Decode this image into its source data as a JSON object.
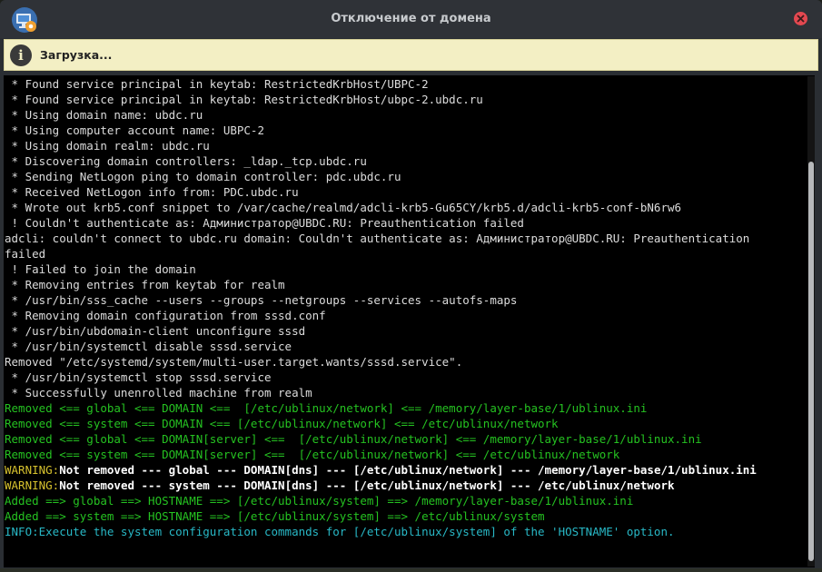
{
  "window": {
    "title": "Отключение от домена",
    "app_icon": "domain-monitor-gear-icon",
    "close_icon": "close-icon"
  },
  "infobar": {
    "icon": "info-icon",
    "text": "Загрузка..."
  },
  "colors": {
    "titlebar": "#2f3237",
    "infobar_bg": "#f3efc4",
    "terminal_bg": "#000000",
    "text_default": "#dcdcdc",
    "text_green": "#25c221",
    "text_cyan": "#28b8c6",
    "warning_keyword": "#d7c22e",
    "close_button": "#e34850"
  },
  "terminal": {
    "scroll_position": 0.96,
    "lines": [
      {
        "style": "default",
        "text": " * Found service principal in keytab: RestrictedKrbHost/UBPC-2"
      },
      {
        "style": "default",
        "text": " * Found service principal in keytab: RestrictedKrbHost/ubpc-2.ubdc.ru"
      },
      {
        "style": "default",
        "text": " * Using domain name: ubdc.ru"
      },
      {
        "style": "default",
        "text": " * Using computer account name: UBPC-2"
      },
      {
        "style": "default",
        "text": " * Using domain realm: ubdc.ru"
      },
      {
        "style": "default",
        "text": " * Discovering domain controllers: _ldap._tcp.ubdc.ru"
      },
      {
        "style": "default",
        "text": " * Sending NetLogon ping to domain controller: pdc.ubdc.ru"
      },
      {
        "style": "default",
        "text": " * Received NetLogon info from: PDC.ubdc.ru"
      },
      {
        "style": "default",
        "text": " * Wrote out krb5.conf snippet to /var/cache/realmd/adcli-krb5-Gu65CY/krb5.d/adcli-krb5-conf-bN6rw6"
      },
      {
        "style": "default",
        "text": " ! Couldn't authenticate as: Администратор@UBDC.RU: Preauthentication failed"
      },
      {
        "style": "default",
        "text": "adcli: couldn't connect to ubdc.ru domain: Couldn't authenticate as: Администратор@UBDC.RU: Preauthentication"
      },
      {
        "style": "default",
        "text": "failed"
      },
      {
        "style": "default",
        "text": " ! Failed to join the domain"
      },
      {
        "style": "default",
        "text": " * Removing entries from keytab for realm"
      },
      {
        "style": "default",
        "text": " * /usr/bin/sss_cache --users --groups --netgroups --services --autofs-maps"
      },
      {
        "style": "default",
        "text": " * Removing domain configuration from sssd.conf"
      },
      {
        "style": "default",
        "text": " * /usr/bin/ubdomain-client unconfigure sssd"
      },
      {
        "style": "default",
        "text": " * /usr/bin/systemctl disable sssd.service"
      },
      {
        "style": "default",
        "text": "Removed \"/etc/systemd/system/multi-user.target.wants/sssd.service\"."
      },
      {
        "style": "default",
        "text": " * /usr/bin/systemctl stop sssd.service"
      },
      {
        "style": "default",
        "text": " * Successfully unenrolled machine from realm"
      },
      {
        "style": "green",
        "text": "Removed <== global <== DOMAIN <==  [/etc/ublinux/network] <== /memory/layer-base/1/ublinux.ini"
      },
      {
        "style": "green",
        "text": "Removed <== system <== DOMAIN <== [/etc/ublinux/network] <== /etc/ublinux/network"
      },
      {
        "style": "green",
        "text": "Removed <== global <== DOMAIN[server] <==  [/etc/ublinux/network] <== /memory/layer-base/1/ublinux.ini"
      },
      {
        "style": "green",
        "text": "Removed <== system <== DOMAIN[server] <==  [/etc/ublinux/network] <== /etc/ublinux/network"
      },
      {
        "style": "warning",
        "keyword": "WARNING:",
        "text": "Not removed --- global --- DOMAIN[dns] --- [/etc/ublinux/network] --- /memory/layer-base/1/ublinux.ini"
      },
      {
        "style": "warning",
        "keyword": "WARNING:",
        "text": "Not removed --- system --- DOMAIN[dns] --- [/etc/ublinux/network] --- /etc/ublinux/network"
      },
      {
        "style": "green",
        "text": "Added ==> global ==> HOSTNAME ==> [/etc/ublinux/system] ==> /memory/layer-base/1/ublinux.ini"
      },
      {
        "style": "green",
        "text": "Added ==> system ==> HOSTNAME ==> [/etc/ublinux/system] ==> /etc/ublinux/system"
      },
      {
        "style": "cyan",
        "text": "INFO:Execute the system configuration commands for [/etc/ublinux/system] of the 'HOSTNAME' option."
      }
    ]
  }
}
